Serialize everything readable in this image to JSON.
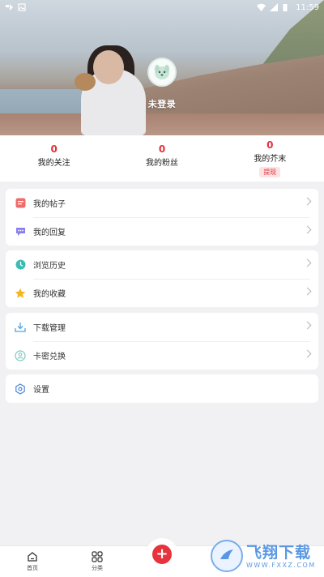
{
  "status_bar": {
    "time": "11:59"
  },
  "profile": {
    "login_prompt": "未登录"
  },
  "stats": [
    {
      "count": "0",
      "label": "我的关注"
    },
    {
      "count": "0",
      "label": "我的粉丝"
    },
    {
      "count": "0",
      "label": "我的芥末",
      "badge": "提现"
    }
  ],
  "menu_groups": [
    [
      {
        "label": "我的帖子",
        "icon": "post-icon"
      },
      {
        "label": "我的回复",
        "icon": "reply-icon"
      }
    ],
    [
      {
        "label": "浏览历史",
        "icon": "clock-icon"
      },
      {
        "label": "我的收藏",
        "icon": "star-icon"
      }
    ],
    [
      {
        "label": "下载管理",
        "icon": "download-icon"
      },
      {
        "label": "卡密兑换",
        "icon": "redeem-icon"
      }
    ],
    [
      {
        "label": "设置",
        "icon": "gear-icon"
      }
    ]
  ],
  "bottom_nav": {
    "home": "首页",
    "category": "分类"
  },
  "watermark": {
    "title": "飞翔下载",
    "url": "WWW.FXXZ.COM"
  },
  "colors": {
    "accent": "#e3333d",
    "page_bg": "#f1f1f3"
  }
}
